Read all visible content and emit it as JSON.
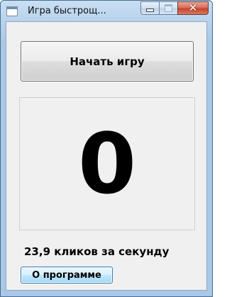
{
  "window": {
    "title": "Игра быстрощ..."
  },
  "title_controls": {
    "minimize_icon": "minimize-icon",
    "maximize_icon": "maximize-icon",
    "close_icon": "close-icon",
    "close_glyph": "✕"
  },
  "main": {
    "start_button_label": "Начать игру",
    "counter_value": "0",
    "rate_text": "23,9 кликов за секунду",
    "about_button_label": "О программе"
  },
  "colors": {
    "frame": "#a9c7e6",
    "client": "#f0f0f0",
    "close_button": "#c7442c",
    "about_button_border": "#3c7fb1"
  }
}
